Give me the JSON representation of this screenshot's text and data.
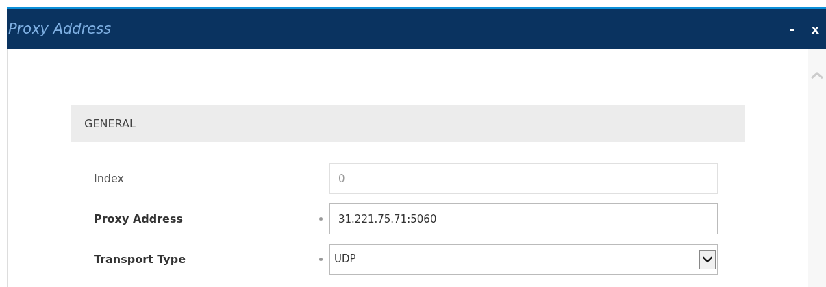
{
  "window": {
    "title": "Proxy Address",
    "controls": [
      "-",
      "x"
    ]
  },
  "section": {
    "title": "GENERAL"
  },
  "fields": [
    {
      "label": "Index",
      "kind": "text",
      "value": "0",
      "required": false,
      "disabled": true
    },
    {
      "label": "Proxy Address",
      "kind": "text",
      "value": "31.221.75.71:5060",
      "required": true,
      "disabled": false
    },
    {
      "label": "Transport Type",
      "kind": "select",
      "value": "UDP",
      "required": true,
      "disabled": false
    }
  ]
}
